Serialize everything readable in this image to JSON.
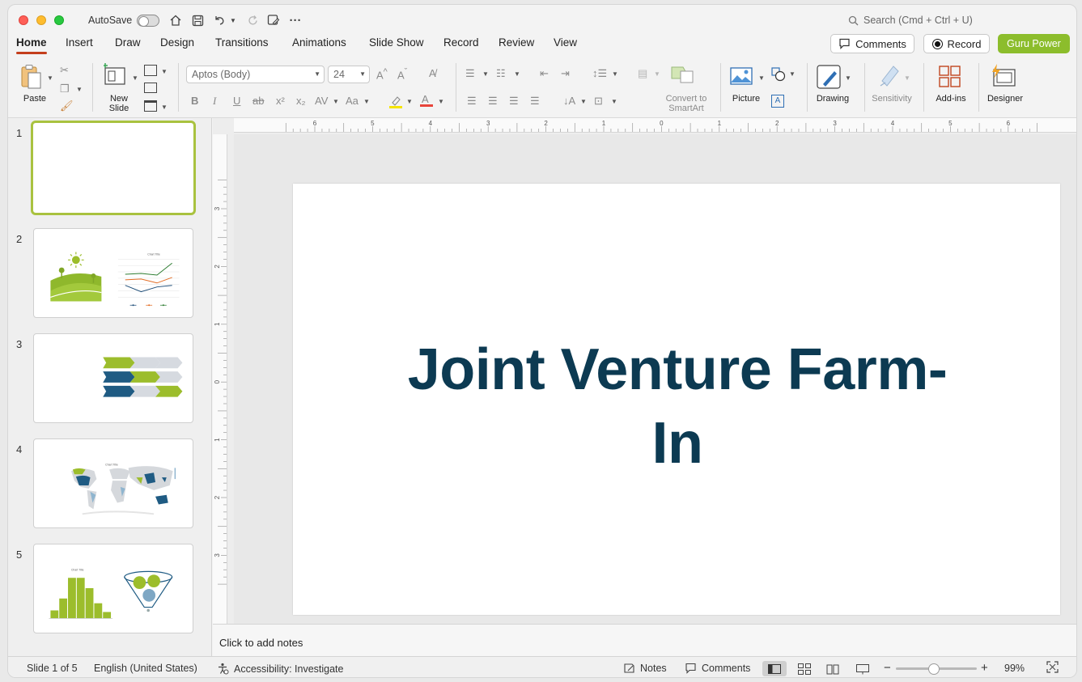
{
  "titlebar": {
    "autosave_label": "AutoSave",
    "search_placeholder": "Search (Cmd + Ctrl + U)"
  },
  "tabs": [
    {
      "label": "Home",
      "active": true
    },
    {
      "label": "Insert"
    },
    {
      "label": "Draw"
    },
    {
      "label": "Design"
    },
    {
      "label": "Transitions"
    },
    {
      "label": "Animations"
    },
    {
      "label": "Slide Show"
    },
    {
      "label": "Record"
    },
    {
      "label": "Review"
    },
    {
      "label": "View"
    }
  ],
  "header_buttons": {
    "comments": "Comments",
    "record": "Record",
    "guru_power": "Guru Power"
  },
  "ribbon": {
    "paste": "Paste",
    "new_slide_line1": "New",
    "new_slide_line2": "Slide",
    "font_name": "Aptos (Body)",
    "font_size": "24",
    "convert_line1": "Convert to",
    "convert_line2": "SmartArt",
    "picture": "Picture",
    "drawing": "Drawing",
    "sensitivity": "Sensitivity",
    "add_ins": "Add-ins",
    "designer": "Designer"
  },
  "ruler": {
    "h_labels": [
      "6",
      "5",
      "4",
      "3",
      "2",
      "1",
      "0",
      "1",
      "2",
      "3",
      "4",
      "5",
      "6"
    ],
    "v_labels": [
      "3",
      "2",
      "1",
      "0",
      "1",
      "2",
      "3"
    ]
  },
  "slides": [
    {
      "number": "1",
      "selected": true
    },
    {
      "number": "2",
      "thumb_chart_title": "Chart Title"
    },
    {
      "number": "3"
    },
    {
      "number": "4",
      "thumb_chart_title": "Chart Title"
    },
    {
      "number": "5",
      "thumb_chart_title": "Chart Title"
    }
  ],
  "current_slide": {
    "title_line1": "Joint Venture Farm-",
    "title_line2": "In"
  },
  "notes_placeholder": "Click to add notes",
  "statusbar": {
    "slide_info": "Slide 1 of 5",
    "language": "English (United States)",
    "accessibility": "Accessibility: Investigate",
    "notes": "Notes",
    "comments": "Comments",
    "zoom": "99%"
  },
  "colors": {
    "accent_green": "#8cbd2c",
    "title_navy": "#0c3a52",
    "tab_underline": "#c43e1c"
  }
}
